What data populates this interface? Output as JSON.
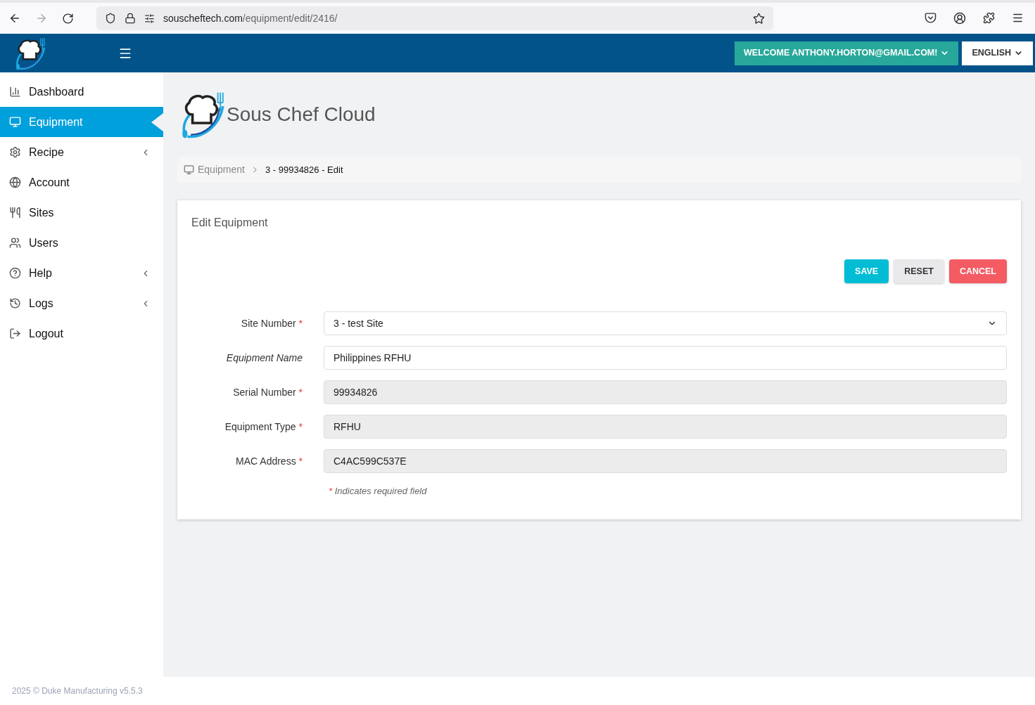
{
  "browser": {
    "url_host": "souscheftech.com",
    "url_path": "/equipment/edit/2416/"
  },
  "header": {
    "welcome": "WELCOME ANTHONY.HORTON@GMAIL.COM!",
    "language": "ENGLISH"
  },
  "sidebar": {
    "items": [
      {
        "label": "Dashboard",
        "selected": false,
        "expandable": false
      },
      {
        "label": "Equipment",
        "selected": true,
        "expandable": false
      },
      {
        "label": "Recipe",
        "selected": false,
        "expandable": true
      },
      {
        "label": "Account",
        "selected": false,
        "expandable": false
      },
      {
        "label": "Sites",
        "selected": false,
        "expandable": false
      },
      {
        "label": "Users",
        "selected": false,
        "expandable": false
      },
      {
        "label": "Help",
        "selected": false,
        "expandable": true
      },
      {
        "label": "Logs",
        "selected": false,
        "expandable": true
      },
      {
        "label": "Logout",
        "selected": false,
        "expandable": false
      }
    ]
  },
  "brand": "Sous Chef Cloud",
  "breadcrumb": [
    "Equipment",
    "3 - 99934826 - Edit"
  ],
  "card": {
    "title": "Edit Equipment",
    "buttons": [
      {
        "label": "SAVE",
        "kind": "primary"
      },
      {
        "label": "RESET",
        "kind": "neutral"
      },
      {
        "label": "CANCEL",
        "kind": "danger"
      }
    ],
    "fields": [
      {
        "label": "Site Number",
        "kind": "select",
        "value": "3 - test Site",
        "required": true,
        "disabled": false
      },
      {
        "label": "Equipment Name",
        "kind": "text",
        "value": "Philippines RFHU",
        "required": false,
        "disabled": false
      },
      {
        "label": "Serial Number",
        "kind": "text",
        "value": "99934826",
        "required": true,
        "disabled": true
      },
      {
        "label": "Equipment Type",
        "kind": "text",
        "value": "RFHU",
        "required": true,
        "disabled": true
      },
      {
        "label": "MAC Address",
        "kind": "text",
        "value": "C4AC599C537E",
        "required": true,
        "disabled": true
      }
    ],
    "required_mark": "*",
    "required_note": "Indicates required field"
  },
  "footer": "2025 © Duke Manufacturing v5.5.3"
}
